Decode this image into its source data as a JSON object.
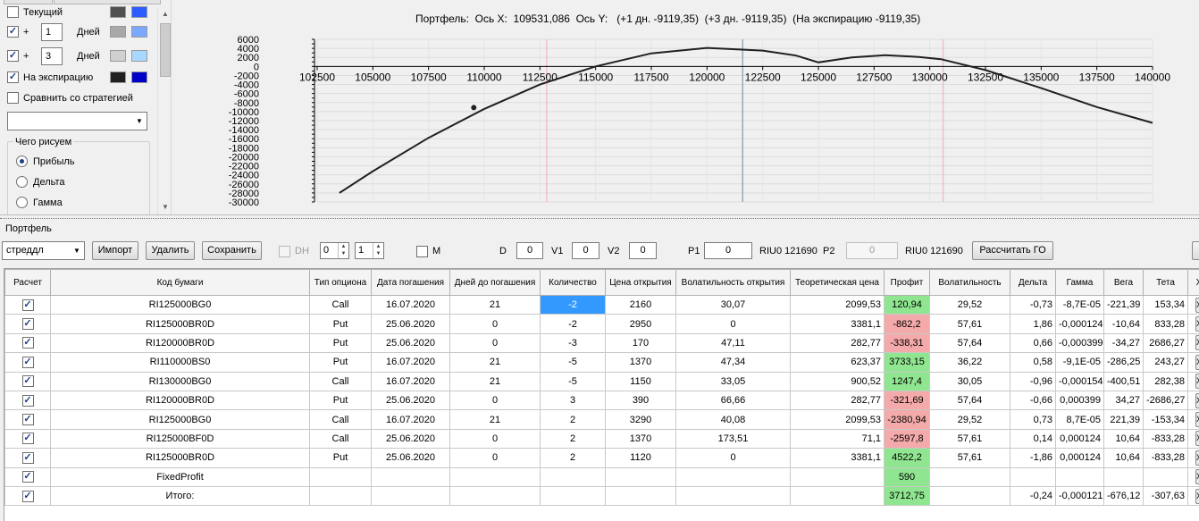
{
  "left_panel": {
    "current": {
      "label": "Текущий",
      "checked": false,
      "color1": "#505050",
      "color2": "#2a5cff"
    },
    "days1": {
      "prefix": "+",
      "value": "1",
      "label": "Дней",
      "checked": true,
      "color1": "#a8a8a8",
      "color2": "#7aa8ff"
    },
    "days2": {
      "prefix": "+",
      "value": "3",
      "label": "Дней",
      "checked": true,
      "color1": "#d0d0d0",
      "color2": "#a8d8ff"
    },
    "expiry": {
      "label": "На экспирацию",
      "checked": true,
      "color1": "#202020",
      "color2": "#0000c8"
    },
    "compare": {
      "label": "Сравнить со стратегией",
      "checked": false
    },
    "strategy_select": {
      "value": ""
    },
    "draw_group": {
      "title": "Чего рисуем",
      "options": [
        {
          "label": "Прибыль",
          "checked": true
        },
        {
          "label": "Дельта",
          "checked": false
        },
        {
          "label": "Гамма",
          "checked": false
        }
      ]
    }
  },
  "chart": {
    "title": "Портфель:  Ось X:  109531,086  Ось Y:   (+1 дн. -9119,35)  (+3 дн. -9119,35)  (На экспирацию -9119,35)",
    "x_ticks": [
      "102500",
      "105000",
      "107500",
      "110000",
      "112500",
      "115000",
      "117500",
      "120000",
      "122500",
      "125000",
      "127500",
      "130000",
      "132500",
      "135000",
      "137500",
      "140000"
    ],
    "y_ticks": [
      "6000",
      "4000",
      "2000",
      "0",
      "-2000",
      "-4000",
      "-6000",
      "-8000",
      "-10000",
      "-12000",
      "-14000",
      "-16000",
      "-18000",
      "-20000",
      "-22000",
      "-24000",
      "-26000",
      "-28000",
      "-30000"
    ]
  },
  "chart_data": {
    "type": "line",
    "title": "",
    "xlim": [
      102500,
      140000
    ],
    "ylim": [
      -30000,
      6000
    ],
    "series": [
      {
        "x": [
          103500,
          105000,
          107500,
          110000,
          112500,
          115000,
          117500,
          120000,
          122500,
          124000,
          125000,
          126500,
          128000,
          129500,
          130500,
          132500,
          135000,
          137500,
          140000
        ],
        "y": [
          -28000,
          -23200,
          -15800,
          -9400,
          -4000,
          0,
          2900,
          4100,
          3500,
          2400,
          900,
          2000,
          2500,
          2100,
          1600,
          -800,
          -4800,
          -9000,
          -12500
        ]
      }
    ],
    "markers": [
      {
        "x": 109531,
        "y": -9119
      }
    ],
    "vlines": [
      {
        "x": 112800,
        "color": "#f0b8c8"
      },
      {
        "x": 121600,
        "color": "#8aa0b0"
      },
      {
        "x": 130600,
        "color": "#f0b8c8"
      }
    ]
  },
  "portfolio": {
    "label": "Портфель",
    "select_value": "стреддл",
    "buttons": {
      "import": "Импорт",
      "delete": "Удалить",
      "save": "Сохранить",
      "calc_go": "Рассчитать ГО"
    },
    "dh_label": "DH",
    "spin1": "0",
    "spin2": "1",
    "m_label": "M",
    "d_label": "D",
    "d_value": "0",
    "v1_label": "V1",
    "v1_value": "0",
    "v2_label": "V2",
    "v2_value": "0",
    "p1_label": "P1",
    "p1_value": "0",
    "p1_info": "RIU0 121690",
    "p2_label": "P2",
    "p2_value": "0",
    "p2_info": "RIU0 121690"
  },
  "grid": {
    "headers": [
      "Расчет",
      "Код бумаги",
      "Тип опциона",
      "Дата погашения",
      "Дней до погашения",
      "Количество",
      "Цена открытия",
      "Волатильность открытия",
      "Теоретическая цена",
      "Профит",
      "Волатильность",
      "Дельта",
      "Гамма",
      "Вега",
      "Тета",
      "X"
    ],
    "rows": [
      {
        "check": true,
        "code": "RI125000BG0",
        "type": "Call",
        "date": "16.07.2020",
        "days": "21",
        "qty": "-2",
        "price": "2160",
        "vol_open": "30,07",
        "theo": "2099,53",
        "profit": "120,94",
        "profit_sign": "pos",
        "vol": "29,52",
        "delta": "-0,73",
        "gamma": "-8,7E-05",
        "vega": "-221,39",
        "theta": "153,34",
        "selected": true
      },
      {
        "check": true,
        "code": "RI125000BR0D",
        "type": "Put",
        "date": "25.06.2020",
        "days": "0",
        "qty": "-2",
        "price": "2950",
        "vol_open": "0",
        "theo": "3381,1",
        "profit": "-862,2",
        "profit_sign": "neg",
        "vol": "57,61",
        "delta": "1,86",
        "gamma": "-0,000124",
        "vega": "-10,64",
        "theta": "833,28"
      },
      {
        "check": true,
        "code": "RI120000BR0D",
        "type": "Put",
        "date": "25.06.2020",
        "days": "0",
        "qty": "-3",
        "price": "170",
        "vol_open": "47,11",
        "theo": "282,77",
        "profit": "-338,31",
        "profit_sign": "neg",
        "vol": "57,64",
        "delta": "0,66",
        "gamma": "-0,000399",
        "vega": "-34,27",
        "theta": "2686,27"
      },
      {
        "check": true,
        "code": "RI110000BS0",
        "type": "Put",
        "date": "16.07.2020",
        "days": "21",
        "qty": "-5",
        "price": "1370",
        "vol_open": "47,34",
        "theo": "623,37",
        "profit": "3733,15",
        "profit_sign": "pos",
        "vol": "36,22",
        "delta": "0,58",
        "gamma": "-9,1E-05",
        "vega": "-286,25",
        "theta": "243,27"
      },
      {
        "check": true,
        "code": "RI130000BG0",
        "type": "Call",
        "date": "16.07.2020",
        "days": "21",
        "qty": "-5",
        "price": "1150",
        "vol_open": "33,05",
        "theo": "900,52",
        "profit": "1247,4",
        "profit_sign": "pos",
        "vol": "30,05",
        "delta": "-0,96",
        "gamma": "-0,000154",
        "vega": "-400,51",
        "theta": "282,38"
      },
      {
        "check": true,
        "code": "RI120000BR0D",
        "type": "Put",
        "date": "25.06.2020",
        "days": "0",
        "qty": "3",
        "price": "390",
        "vol_open": "66,66",
        "theo": "282,77",
        "profit": "-321,69",
        "profit_sign": "neg",
        "vol": "57,64",
        "delta": "-0,66",
        "gamma": "0,000399",
        "vega": "34,27",
        "theta": "-2686,27"
      },
      {
        "check": true,
        "code": "RI125000BG0",
        "type": "Call",
        "date": "16.07.2020",
        "days": "21",
        "qty": "2",
        "price": "3290",
        "vol_open": "40,08",
        "theo": "2099,53",
        "profit": "-2380,94",
        "profit_sign": "neg",
        "vol": "29,52",
        "delta": "0,73",
        "gamma": "8,7E-05",
        "vega": "221,39",
        "theta": "-153,34"
      },
      {
        "check": true,
        "code": "RI125000BF0D",
        "type": "Call",
        "date": "25.06.2020",
        "days": "0",
        "qty": "2",
        "price": "1370",
        "vol_open": "173,51",
        "theo": "71,1",
        "profit": "-2597,8",
        "profit_sign": "neg",
        "vol": "57,61",
        "delta": "0,14",
        "gamma": "0,000124",
        "vega": "10,64",
        "theta": "-833,28"
      },
      {
        "check": true,
        "code": "RI125000BR0D",
        "type": "Put",
        "date": "25.06.2020",
        "days": "0",
        "qty": "2",
        "price": "1120",
        "vol_open": "0",
        "theo": "3381,1",
        "profit": "4522,2",
        "profit_sign": "pos",
        "vol": "57,61",
        "delta": "-1,86",
        "gamma": "0,000124",
        "vega": "10,64",
        "theta": "-833,28"
      }
    ],
    "fixed_row": {
      "check": true,
      "code": "FixedProfit",
      "profit": "590",
      "profit_sign": "pos"
    },
    "total_row": {
      "check": true,
      "code": "Итого:",
      "profit": "3712,75",
      "profit_sign": "pos",
      "delta": "-0,24",
      "gamma": "-0,000121",
      "vega": "-676,12",
      "theta": "-307,63"
    },
    "x_button": "X"
  }
}
